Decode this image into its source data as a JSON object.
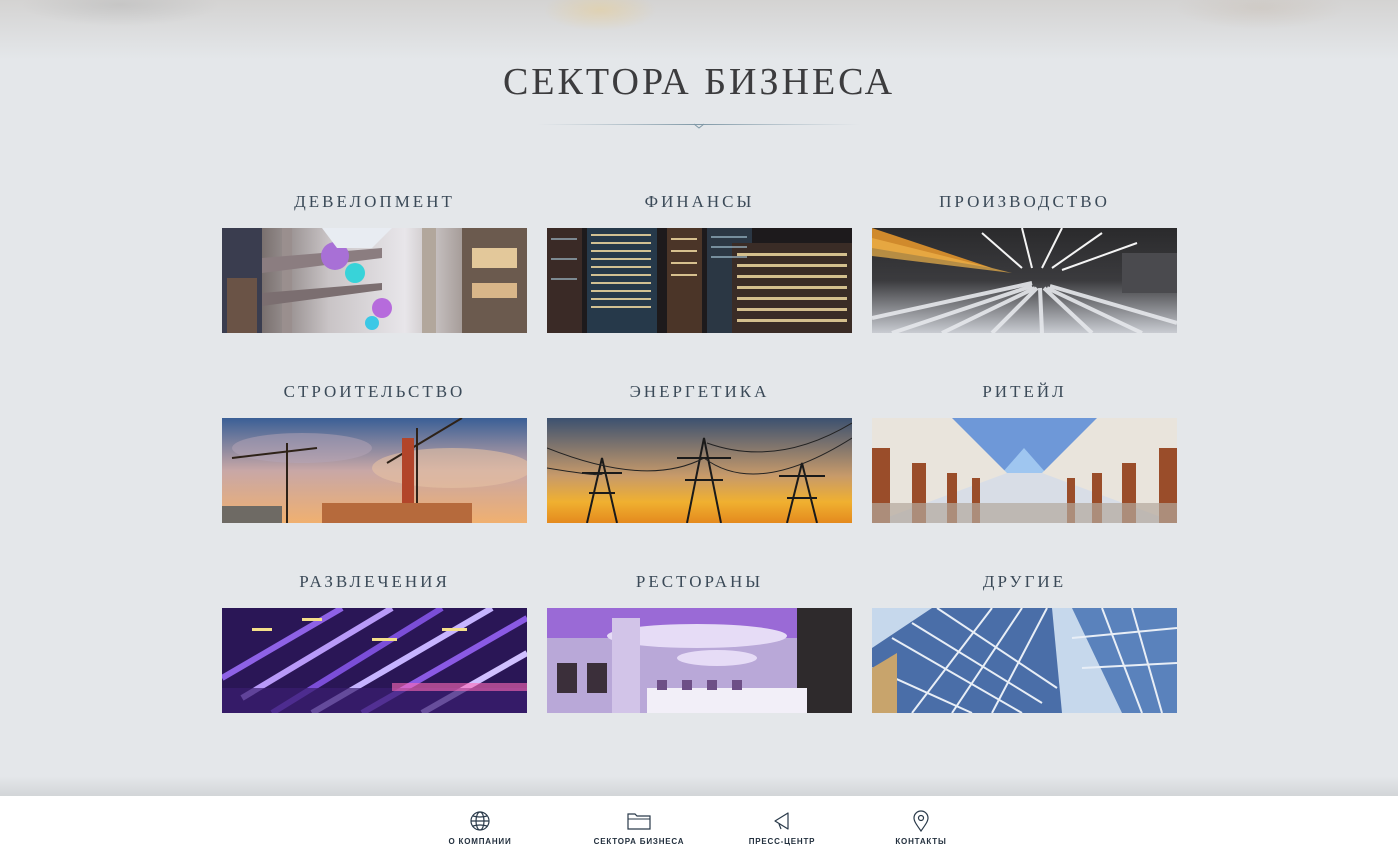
{
  "page": {
    "title": "СЕКТОРА БИЗНЕСА"
  },
  "sectors": [
    {
      "label": "ДЕВЕЛОПМЕНТ",
      "image": "atrium-mall-photo"
    },
    {
      "label": "ФИНАНСЫ",
      "image": "night-skyscrapers-photo"
    },
    {
      "label": "ПРОИЗВОДСТВО",
      "image": "factory-hall-photo"
    },
    {
      "label": "СТРОИТЕЛЬСТВО",
      "image": "construction-cranes-photo"
    },
    {
      "label": "ЭНЕРГЕТИКА",
      "image": "power-lines-sunset-photo"
    },
    {
      "label": "РИТЕЙЛ",
      "image": "shopping-gallery-photo"
    },
    {
      "label": "РАЗВЛЕЧЕНИЯ",
      "image": "neon-lights-photo"
    },
    {
      "label": "РЕСТОРАНЫ",
      "image": "restaurant-interior-photo"
    },
    {
      "label": "ДРУГИЕ",
      "image": "glass-roof-photo"
    }
  ],
  "footer_nav": [
    {
      "label": "О КОМПАНИИ",
      "icon": "globe-icon"
    },
    {
      "label": "СЕКТОРА БИЗНЕСА",
      "icon": "folder-icon"
    },
    {
      "label": "ПРЕСС-ЦЕНТР",
      "icon": "megaphone-icon"
    },
    {
      "label": "КОНТАКТЫ",
      "icon": "location-pin-icon"
    }
  ],
  "colors": {
    "background": "#e4e7ea",
    "title": "#3c3c3e",
    "label": "#3b4a58",
    "footer_bg": "#ffffff"
  }
}
